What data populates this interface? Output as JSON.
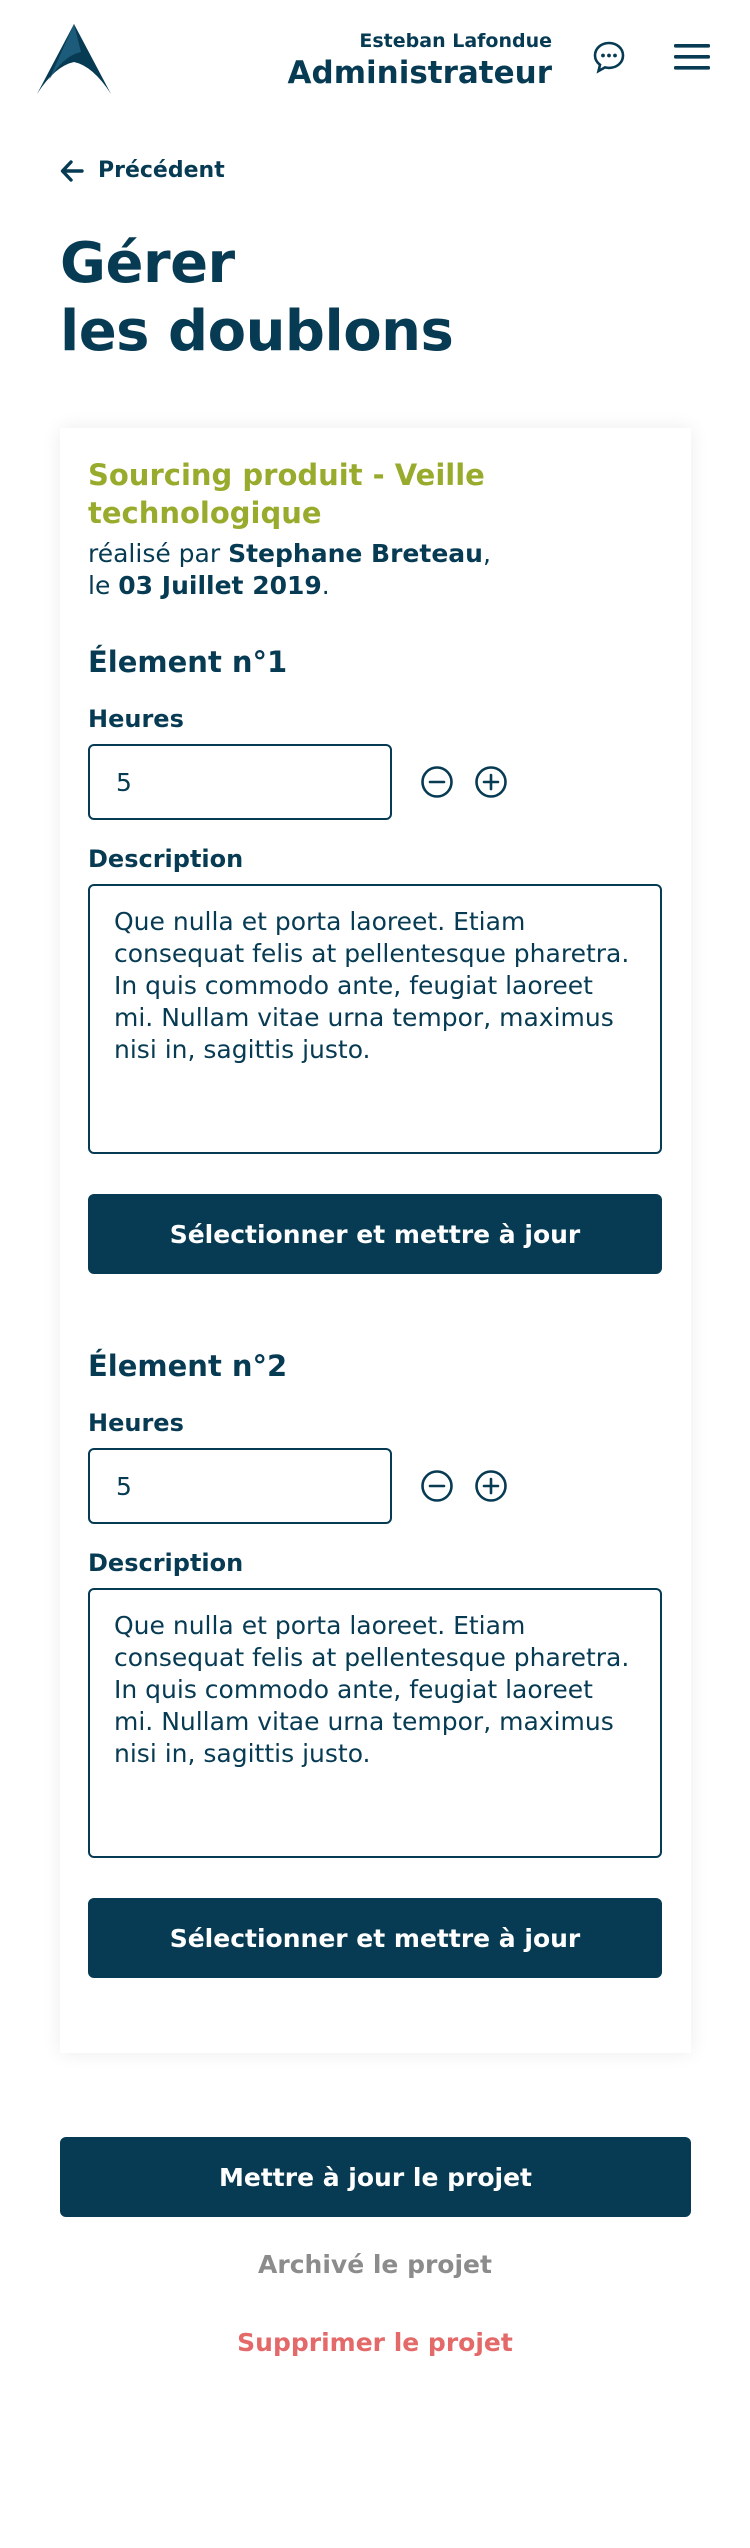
{
  "header": {
    "logo_icon": "brand-logo-icon",
    "user_name": "Esteban Lafondue",
    "user_role": "Administrateur",
    "chat_icon": "chat-bubble-icon",
    "menu_icon": "hamburger-menu-icon"
  },
  "back": {
    "label": "Précédent",
    "icon": "arrow-left-icon"
  },
  "page": {
    "title_line1": "Gérer",
    "title_line2": "les doublons"
  },
  "project": {
    "title": "Sourcing produit - Veille technologique",
    "meta_prefix": "réalisé par ",
    "author": "Stephane Breteau",
    "meta_mid": ",",
    "date_prefix": "le ",
    "date": "03 Juillet 2019",
    "date_suffix": "."
  },
  "elements": [
    {
      "title": "Élement n°1",
      "hours_label": "Heures",
      "hours_value": "5",
      "description_label": "Description",
      "description": "Que nulla et porta laoreet. Etiam consequat felis at pellentesque pharetra. In quis commodo ante, feugiat laoreet mi. Nullam vitae urna tempor, maximus nisi in, sagittis justo.",
      "button_label": "Sélectionner et mettre à jour"
    },
    {
      "title": "Élement n°2",
      "hours_label": "Heures",
      "hours_value": "5",
      "description_label": "Description",
      "description": "Que nulla et porta laoreet. Etiam consequat felis at pellentesque pharetra. In quis commodo ante, feugiat laoreet mi. Nullam vitae urna tempor, maximus nisi in, sagittis justo.",
      "button_label": "Sélectionner et mettre à jour"
    }
  ],
  "actions": {
    "update_project": "Mettre à jour le projet",
    "archive_project": "Archivé le projet",
    "delete_project": "Supprimer le projet"
  },
  "colors": {
    "primary": "#073b53",
    "accent_green": "#99ab2d",
    "muted": "#8c8c8c",
    "danger": "#e46a6a"
  }
}
